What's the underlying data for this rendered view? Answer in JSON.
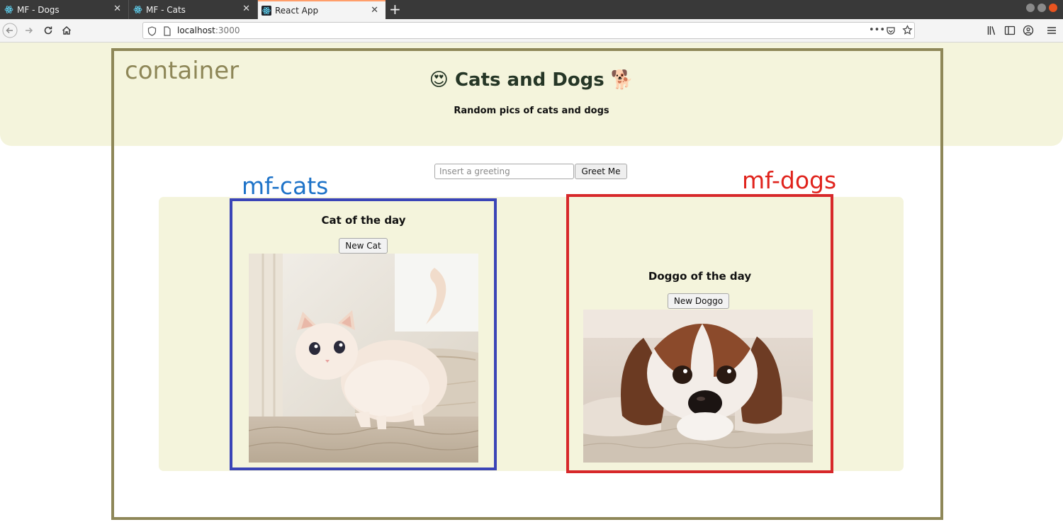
{
  "browser": {
    "tabs": [
      {
        "label": "MF - Dogs",
        "active": false
      },
      {
        "label": "MF - Cats",
        "active": false
      },
      {
        "label": "React App",
        "active": true
      }
    ],
    "url": {
      "host": "localhost",
      "port": ":3000"
    }
  },
  "header": {
    "title": "Cats and Dogs",
    "title_emoji_left": "😍",
    "title_emoji_right": "🐕",
    "subtitle": "Random pics of cats and dogs"
  },
  "greeting": {
    "placeholder": "Insert a greeting",
    "button_label": "Greet Me"
  },
  "cats": {
    "title": "Cat of the day",
    "button_label": "New Cat"
  },
  "dogs": {
    "title": "Doggo of the day",
    "button_label": "New Doggo"
  },
  "annotations": {
    "container": {
      "label": "container",
      "color": "#8e8758"
    },
    "mf_cats": {
      "label": "mf-cats",
      "color": "#1e73c8"
    },
    "mf_dogs": {
      "label": "mf-dogs",
      "color": "#e0231c"
    }
  },
  "colors": {
    "band": "#f4f4dc",
    "title": "#253626",
    "tab_accent": "#ff9e6a"
  }
}
